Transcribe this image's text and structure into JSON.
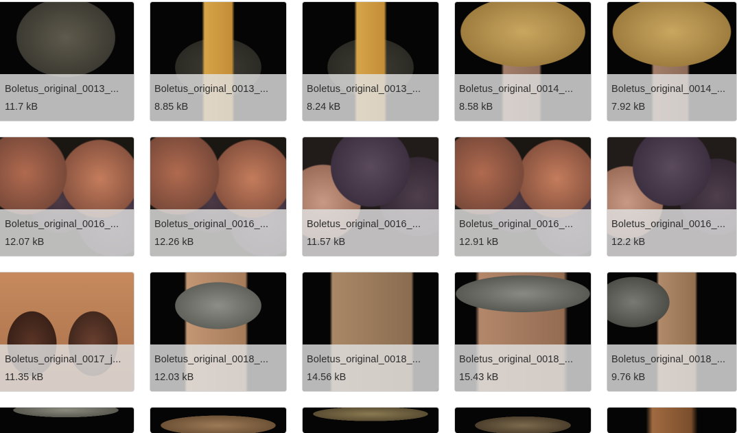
{
  "files": [
    {
      "name": "Boletus_original_0013_...",
      "size": "11.7 kB",
      "thumb": "cap-dark"
    },
    {
      "name": "Boletus_original_0013_...",
      "size": "8.85 kB",
      "thumb": "stem-yellow"
    },
    {
      "name": "Boletus_original_0013_...",
      "size": "8.24 kB",
      "thumb": "stem-yellow"
    },
    {
      "name": "Boletus_original_0014_...",
      "size": "8.58 kB",
      "thumb": "tan-cap"
    },
    {
      "name": "Boletus_original_0014_...",
      "size": "7.92 kB",
      "thumb": "tan-cap"
    },
    {
      "name": "Boletus_original_0016_...",
      "size": "12.07 kB",
      "thumb": "cluster"
    },
    {
      "name": "Boletus_original_0016_...",
      "size": "12.26 kB",
      "thumb": "cluster"
    },
    {
      "name": "Boletus_original_0016_...",
      "size": "11.57 kB",
      "thumb": "cluster2"
    },
    {
      "name": "Boletus_original_0016_...",
      "size": "12.91 kB",
      "thumb": "cluster"
    },
    {
      "name": "Boletus_original_0016_...",
      "size": "12.2 kB",
      "thumb": "cluster2"
    },
    {
      "name": "Boletus_original_0017_j...",
      "size": "11.35 kB",
      "thumb": "brown-caps"
    },
    {
      "name": "Boletus_original_0018_...",
      "size": "12.03 kB",
      "thumb": "grey-cap"
    },
    {
      "name": "Boletus_original_0018_...",
      "size": "14.56 kB",
      "thumb": "stem-brown"
    },
    {
      "name": "Boletus_original_0018_...",
      "size": "15.43 kB",
      "thumb": "stem-brown2"
    },
    {
      "name": "Boletus_original_0018_...",
      "size": "9.76 kB",
      "thumb": "mixed"
    }
  ],
  "partial_row": [
    "row4-a",
    "row4-b",
    "row4-c",
    "row4-d",
    "row4-e"
  ]
}
